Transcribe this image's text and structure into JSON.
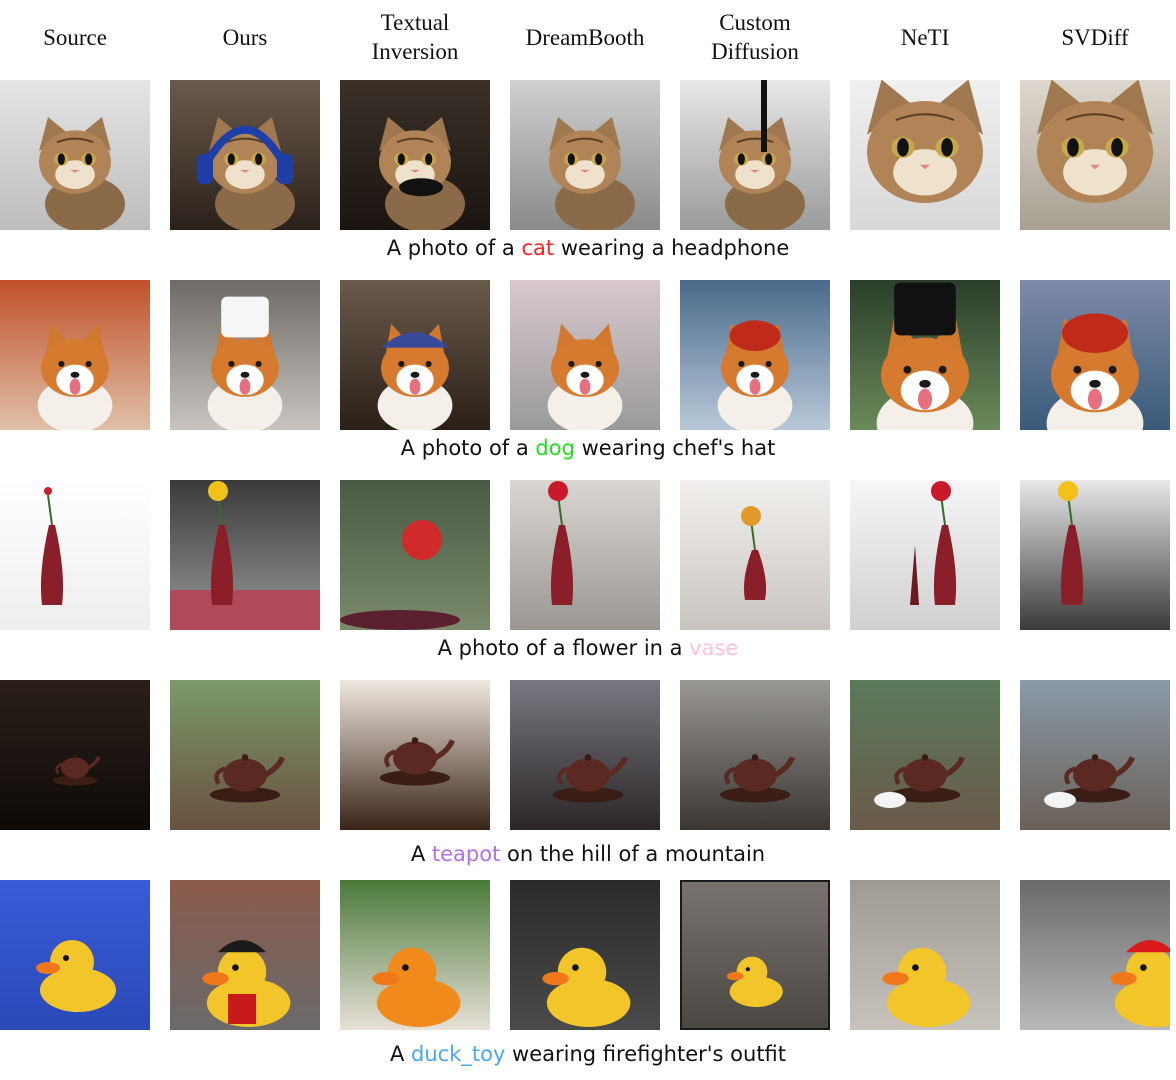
{
  "columns": [
    "Source",
    "Ours",
    "Textual Inversion",
    "DreamBooth",
    "Custom Diffusion",
    "NeTI",
    "SVDiff"
  ],
  "column_lines": [
    [
      "Source"
    ],
    [
      "Ours"
    ],
    [
      "Textual",
      "Inversion"
    ],
    [
      "DreamBooth"
    ],
    [
      "Custom",
      "Diffusion"
    ],
    [
      "NeTI"
    ],
    [
      "SVDiff"
    ]
  ],
  "rows": [
    {
      "subject": "cat",
      "prompt_before": "A photo of a ",
      "keyword": "cat",
      "prompt_after": " wearing a headphone",
      "keyword_color": "#ff2020"
    },
    {
      "subject": "dog",
      "prompt_before": "A photo of a ",
      "keyword": "dog",
      "prompt_after": " wearing chef's hat",
      "keyword_color": "#22dd22"
    },
    {
      "subject": "vase",
      "prompt_before": "A photo of a flower in a ",
      "keyword": "vase",
      "prompt_after": "",
      "keyword_color": "#ffc0dc"
    },
    {
      "subject": "teapot",
      "prompt_before": "A ",
      "keyword": "teapot",
      "prompt_after": " on the hill of a mountain",
      "keyword_color": "#b070f0"
    },
    {
      "subject": "duck_toy",
      "prompt_before": "A ",
      "keyword": "duck_toy",
      "prompt_after": " wearing firefighter's outfit",
      "keyword_color": "#4aa8ee"
    }
  ]
}
